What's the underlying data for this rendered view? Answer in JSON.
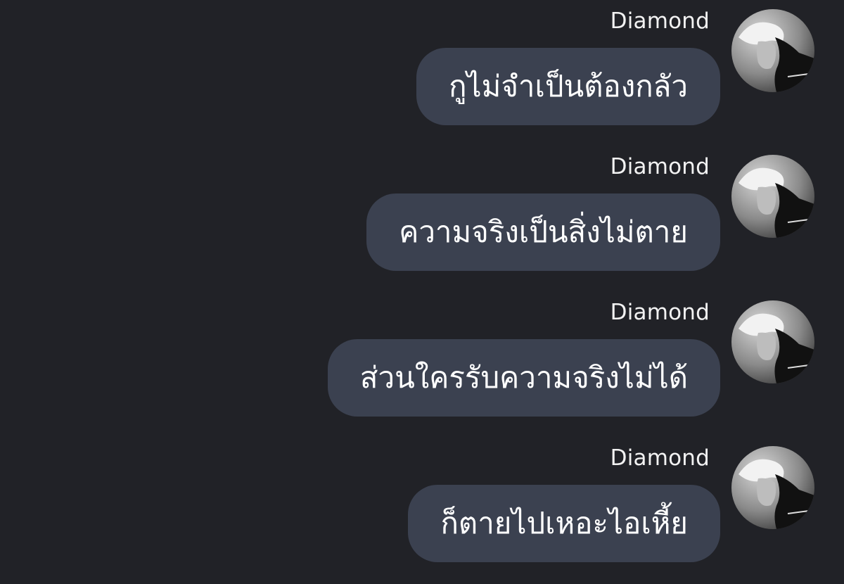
{
  "messages": [
    {
      "sender": "Diamond",
      "text": "กูไม่จำเป็นต้องกลัว"
    },
    {
      "sender": "Diamond",
      "text": "ความจริงเป็นสิ่งไม่ตาย"
    },
    {
      "sender": "Diamond",
      "text": "ส่วนใครรับความจริงไม่ได้"
    },
    {
      "sender": "Diamond",
      "text": "ก็ตายไปเหอะไอเหี้ย"
    }
  ],
  "colors": {
    "background": "#212227",
    "bubble": "#3b4150",
    "text": "#ffffff"
  },
  "avatar_icon": "user-photo-avatar"
}
